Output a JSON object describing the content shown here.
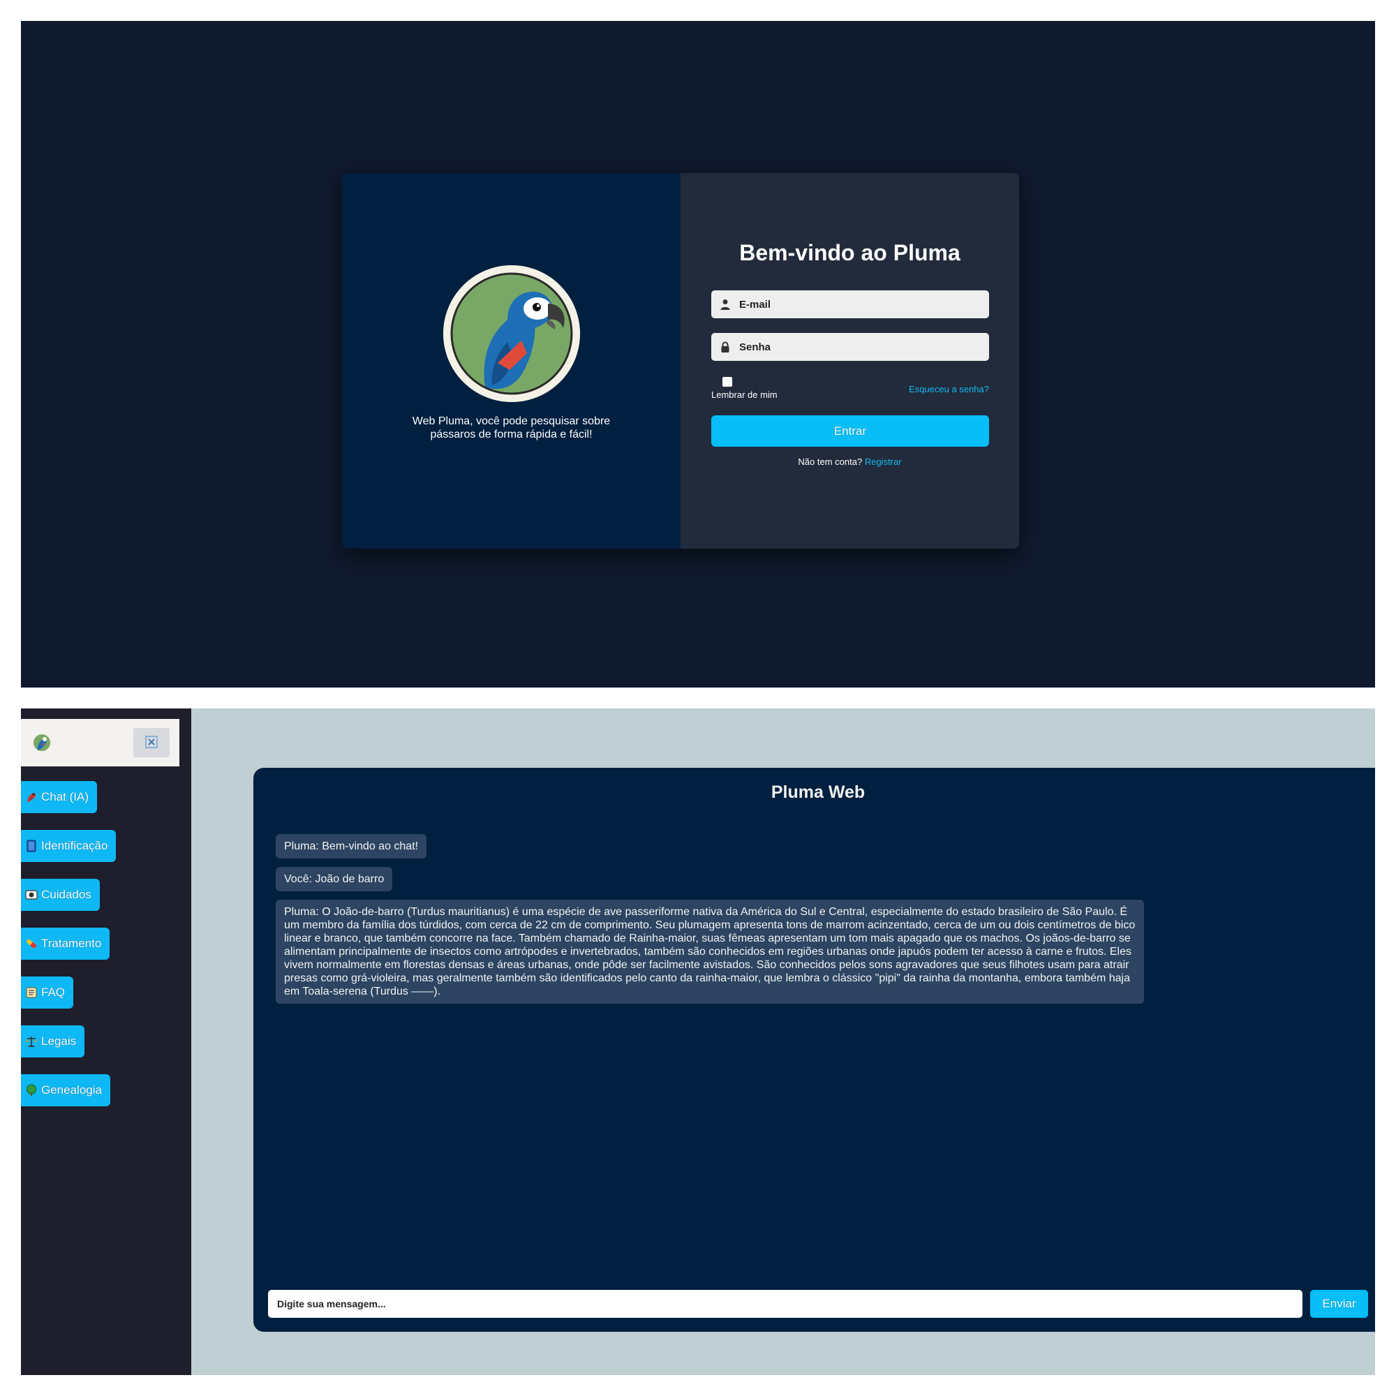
{
  "login": {
    "tagline": "Web Pluma, você pode pesquisar sobre pássaros de forma rápida e fácil!",
    "title": "Bem-vindo ao Pluma",
    "email_placeholder": "E-mail",
    "password_placeholder": "Senha",
    "remember_label": "Lembrar de mim",
    "forgot_label": "Esqueceu a senha?",
    "submit_label": "Entrar",
    "register_prompt": "Não tem conta?",
    "register_label": "Registrar"
  },
  "sidebar": {
    "items": [
      {
        "label": "Chat (IA)",
        "icon": "parrot-icon"
      },
      {
        "label": "Identificação",
        "icon": "book-icon"
      },
      {
        "label": "Cuidados",
        "icon": "cuidados-icon"
      },
      {
        "label": "Tratamento",
        "icon": "pill-icon"
      },
      {
        "label": "FAQ",
        "icon": "faq-icon"
      },
      {
        "label": "Legais",
        "icon": "scales-icon"
      },
      {
        "label": "Genealogia",
        "icon": "tree-icon"
      }
    ]
  },
  "chat": {
    "title": "Pluma Web",
    "messages": [
      "Pluma: Bem-vindo ao chat!",
      "Você: João de barro",
      "Pluma: O João-de-barro (Turdus mauritianus) é uma espécie de ave passeriforme nativa da América do Sul e Central, especialmente do estado brasileiro de São Paulo. É um membro da família dos túrdidos, com cerca de 22 cm de comprimento. Seu plumagem apresenta tons de marrom acinzentado, cerca de um ou dois centímetros de bico linear e branco, que também concorre na face. Também chamado de Rainha-maior, suas fêmeas apresentam um tom mais apagado que os machos. Os joãos-de-barro se alimentam principalmente de insectos como artrópodes e invertebrados, também são conhecidos em regiões urbanas onde japuós podem ter acesso à carne e frutos. Eles vivem normalmente em florestas densas e áreas urbanas, onde pôde ser facilmente avistados. São conhecidos pelos sons agravadores que seus filhotes usam para atrair presas como grá-violeira, mas geralmente também são identificados pelo canto da rainha-maior, que lembra o clássico \"pipi\" da rainha da montanha, embora também haja em Toala-serena (Turdus ——)."
    ],
    "input_placeholder": "Digite sua mensagem...",
    "send_label": "Enviar"
  },
  "colors": {
    "accent": "#07bef7",
    "login_bg": "#101a2e",
    "card_left": "#011f3f",
    "card_right": "#222b3b",
    "chat_bg": "#c0cfd4",
    "sidebar_bg": "#1e1e2c",
    "bubble": "#2d4562"
  }
}
